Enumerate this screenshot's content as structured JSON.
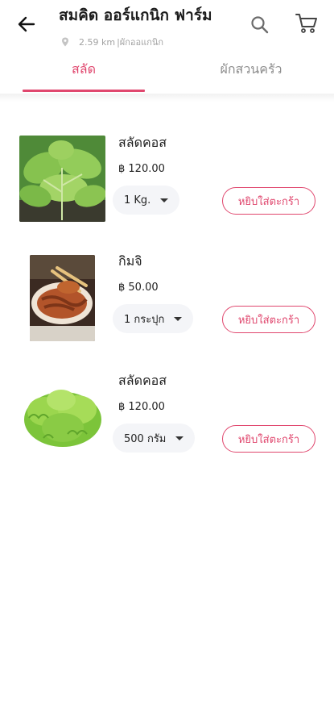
{
  "header": {
    "title": "สมคิด ออร์แกนิก ฟาร์ม",
    "distance": "2.59 km",
    "separator": "|",
    "category": "ผักออแกนิก"
  },
  "tabs": [
    {
      "label": "สลัด",
      "active": true
    },
    {
      "label": "ผักสวนครัว",
      "active": false
    }
  ],
  "colors": {
    "accent": "#e0476e",
    "muted": "#8d8d8d"
  },
  "products": [
    {
      "name": "สลัดคอส",
      "price": "฿ 120.00",
      "unit": "1 Kg.",
      "add_label": "หยิบใส่ตะกร้า",
      "image": "romaine-lettuce"
    },
    {
      "name": "กิมจิ",
      "price": "฿ 50.00",
      "unit": "1 กระปุก",
      "add_label": "หยิบใส่ตะกร้า",
      "image": "kimchi"
    },
    {
      "name": "สลัดคอส",
      "price": "฿ 120.00",
      "unit": "500 กรัม",
      "add_label": "หยิบใส่ตะกร้า",
      "image": "green-oak-lettuce"
    }
  ]
}
